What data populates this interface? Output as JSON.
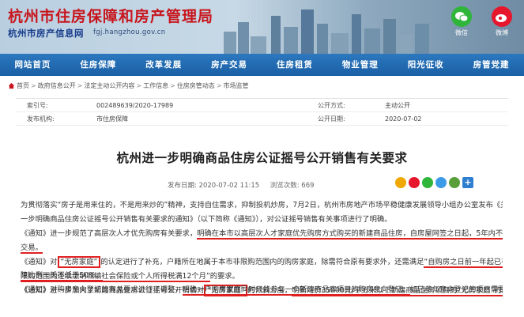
{
  "header": {
    "title": "杭州市住房保障和房产管理局",
    "subtitle": "杭州市房产信息网",
    "url": "fgj.hangzhou.gov.cn",
    "social": [
      {
        "label": "微信",
        "icon": "wechat-icon",
        "color": "#2fb53a"
      },
      {
        "label": "微博",
        "icon": "weibo-icon",
        "color": "#e6162d"
      }
    ]
  },
  "nav": {
    "items": [
      "网站首页",
      "住房保障",
      "改革发展",
      "房产交易",
      "住房租赁",
      "物业管理",
      "阳光征收",
      "房管党建"
    ]
  },
  "breadcrumb": {
    "items": [
      "首页",
      "政府信息公开",
      "法定主动公开内容",
      "工作信息",
      "住房房管动态",
      "市场监管"
    ]
  },
  "meta": {
    "rows": [
      {
        "k1": "索引号:",
        "v1": "002489639/2020-17989",
        "k2": "公开方式:",
        "v2": "主动公开"
      },
      {
        "k1": "发布机构:",
        "v1": "市住房保障",
        "k2": "公开日期:",
        "v2": "2020-07-02"
      }
    ]
  },
  "article": {
    "title": "杭州进一步明确商品住房公证摇号公开销售有关要求",
    "publish_label": "发布日期:",
    "publish_date": "2020-07-02 11:15",
    "views_label": "浏览次数:",
    "views": "669"
  },
  "paragraphs": {
    "p1": {
      "l1": "为贯彻落实“房子是用来住的，不是用来炒的”精神，支持自住需求，抑制投机炒房，7月2日，杭州市房地产市场平稳健康发展领导小组办公室发布《关于进",
      "l2": "一步明确商品住房公证摇号公开销售有关要求的通知》（以下简称《通知》），对公证摇号销售有关事项进行了明确。"
    },
    "p2": {
      "a": "《通知》进一步规范了高层次人才优先购房有关要求，",
      "b": "明确在本市以高层次人才家庭优先购房方式购买的新建商品住房，自房屋网签之日起，5年内不得上市",
      "c": "交易。"
    },
    "p3": {
      "a": "《通知》对",
      "b": "“无房家庭”",
      "c": "的认定进行了补充，户籍所在地属于本市非限购范围内的购房家庭，除需符合原有要求外，还需满足",
      "d": "“自购房之日前一年起已在本市",
      "e": "限购范围内连续缴纳城镇社会保险或个人所得税满12个月”",
      "f": "的要求。"
    },
    "p4": {
      "a": "《通知》进一步加大了新建商品住房公证摇号公开销售对",
      "b": "“无房家庭”",
      "c": "的倾斜力度，",
      "d": "明确均价35000元/平方米以下新建商品住房项目的“无房家庭”的房源保",
      "e": "障比例一般不低于50%。"
    },
    "p5": {
      "a": "《通知》对购房意向登记的有关要求进行了调整，",
      "b": "明确一户购房家庭同时只能参与一个新建商品房项目的购房意向登记。",
      "c": "如已参与意向登记的项目需要摇号"
    }
  },
  "colors": {
    "accent_red": "#e02020",
    "nav_blue": "#1a5fa5",
    "title_red": "#c8161d"
  }
}
